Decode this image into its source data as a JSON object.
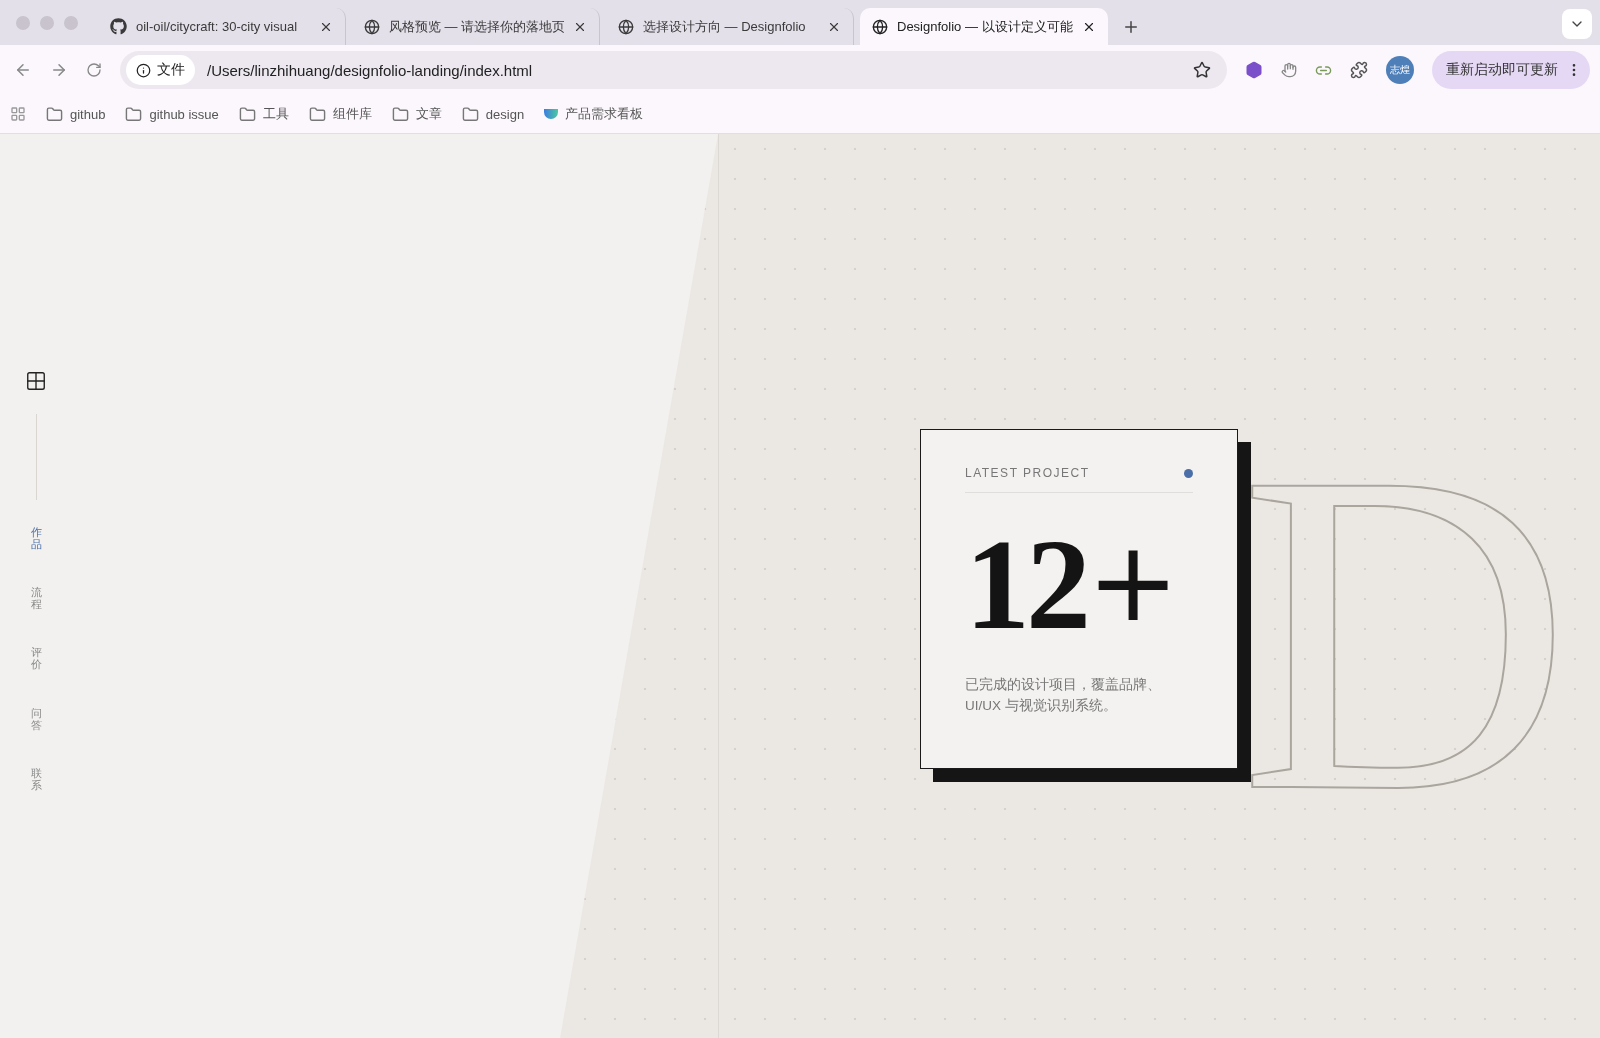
{
  "browser": {
    "tabs": [
      {
        "title": "oil-oil/citycraft: 30-city visual",
        "kind": "repo",
        "selected": false
      },
      {
        "title": "风格预览 — 请选择你的落地页",
        "kind": "page",
        "selected": false
      },
      {
        "title": "选择设计方向 — Designfolio",
        "kind": "page",
        "selected": false
      },
      {
        "title": "Designfolio — 以设计定义可能",
        "kind": "page",
        "selected": true
      }
    ],
    "address": {
      "chip": "文件",
      "url": "/Users/linzhihuang/designfolio-landing/index.html"
    },
    "profile": {
      "initials": "志煌"
    },
    "update_button": "重新启动即可更新",
    "bookmarks": [
      {
        "label": "github",
        "kind": "folder"
      },
      {
        "label": "github issue",
        "kind": "folder"
      },
      {
        "label": "工具",
        "kind": "folder"
      },
      {
        "label": "组件库",
        "kind": "folder"
      },
      {
        "label": "文章",
        "kind": "folder"
      },
      {
        "label": "design",
        "kind": "folder"
      },
      {
        "label": "产品需求看板",
        "kind": "app"
      }
    ]
  },
  "page": {
    "nav": [
      {
        "label": "作品",
        "selected": true
      },
      {
        "label": "流程",
        "selected": false
      },
      {
        "label": "评价",
        "selected": false
      },
      {
        "label": "问答",
        "selected": false
      },
      {
        "label": "联系",
        "selected": false
      }
    ],
    "card": {
      "eyebrow": "LATEST PROJECT",
      "stat": "12",
      "stat_suffix": "+",
      "description": "已完成的设计项目，覆盖品牌、UI/UX 与视觉识别系统。"
    },
    "backdrop_letters": "D"
  }
}
